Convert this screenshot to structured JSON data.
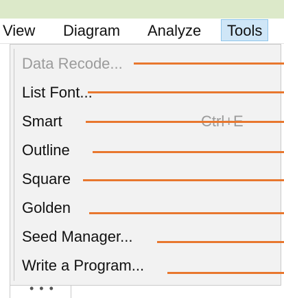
{
  "menubar": {
    "items": [
      {
        "label": "View",
        "active": false
      },
      {
        "label": "Diagram",
        "active": false
      },
      {
        "label": "Analyze",
        "active": false
      },
      {
        "label": "Tools",
        "active": true
      }
    ]
  },
  "dropdown": {
    "items": [
      {
        "label": "Data Recode...",
        "enabled": false,
        "shortcut": ""
      },
      {
        "label": "List Font...",
        "enabled": true,
        "shortcut": ""
      },
      {
        "label": "Smart",
        "enabled": true,
        "shortcut": "Ctrl+E"
      },
      {
        "label": "Outline",
        "enabled": true,
        "shortcut": ""
      },
      {
        "label": "Square",
        "enabled": true,
        "shortcut": ""
      },
      {
        "label": "Golden",
        "enabled": true,
        "shortcut": ""
      },
      {
        "label": "Seed Manager...",
        "enabled": true,
        "shortcut": ""
      },
      {
        "label": "Write a Program...",
        "enabled": true,
        "shortcut": ""
      }
    ]
  },
  "colors": {
    "callout": "#e8772e",
    "active_menu_bg": "#cfe6f7",
    "top_strip": "#dce9c9"
  }
}
